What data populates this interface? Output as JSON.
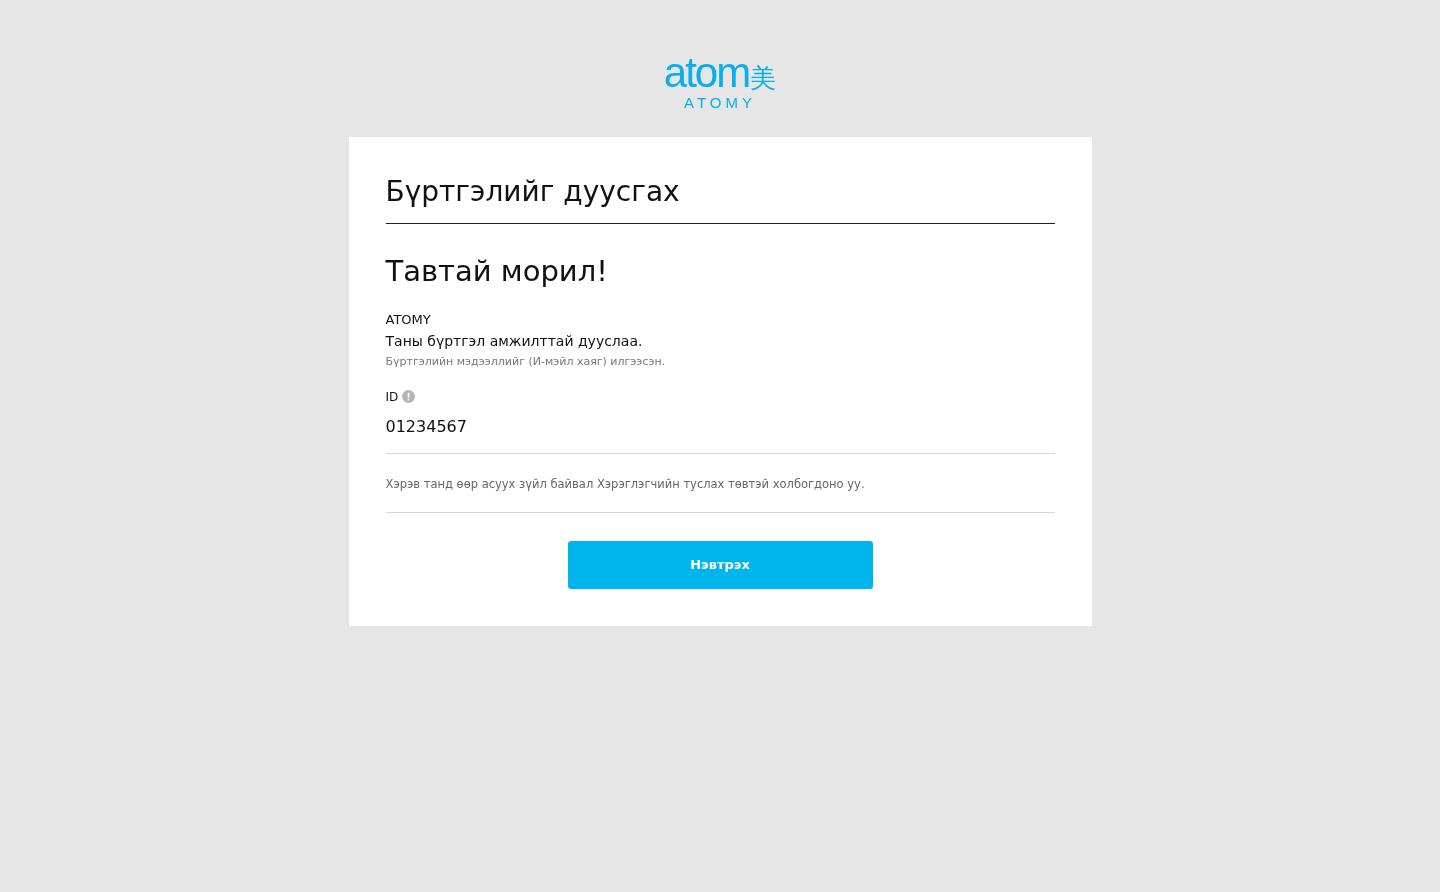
{
  "logo": {
    "wordmark": "atom",
    "mark": "美",
    "subtitle": "ATOMY"
  },
  "card": {
    "title": "Бүртгэлийг дуусгах",
    "greeting": "Тавтай морил!",
    "company": "ATOMY",
    "message": "Таны бүртгэл амжилттай дууслаа.",
    "note": "Бүртгэлийн мэдээллийг (И-мэйл хаяг) илгээсэн.",
    "id_label": "ID",
    "id_value": "01234567",
    "help": "Хэрэв танд өөр асуух зүйл байвал Хэрэглэгчийн туслах төвтэй холбогдоно уу.",
    "button": "Нэвтрэх"
  }
}
